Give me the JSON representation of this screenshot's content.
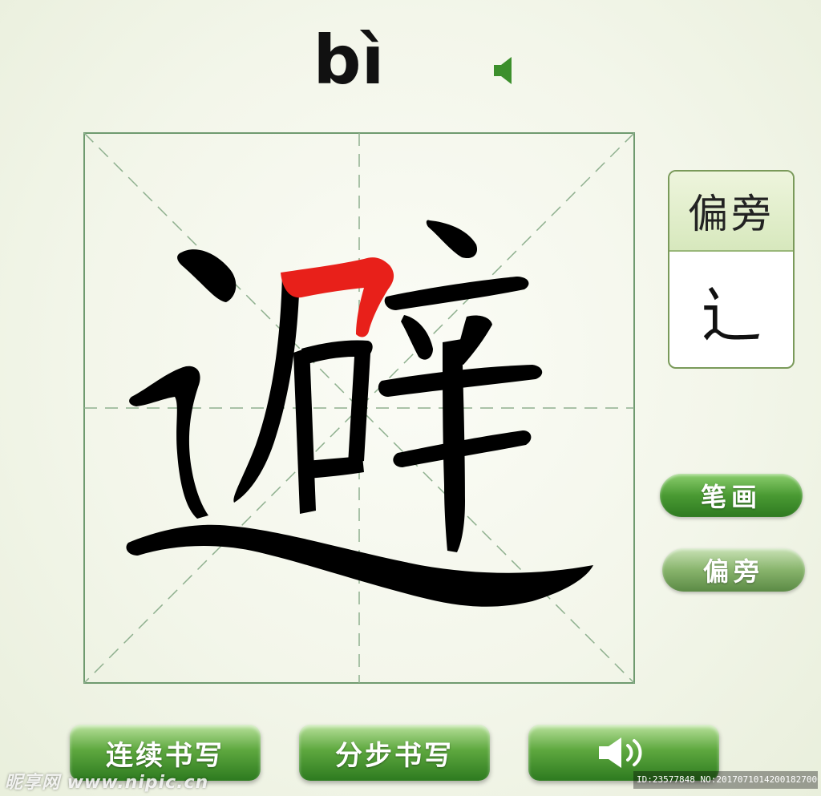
{
  "pinyin": "bì",
  "radical_panel": {
    "title": "偏旁",
    "radical": "辶"
  },
  "side_buttons": {
    "strokes": "笔画",
    "radical": "偏旁"
  },
  "bottom_buttons": {
    "continuous": "连续书写",
    "step": "分步书写"
  },
  "watermark": {
    "site": "昵享网 www.nipic.cn",
    "id": "ID:23577848 NO:20170710142001827000"
  },
  "colors": {
    "stroke": "#000000",
    "highlight_stroke": "#e8201a",
    "grid_line": "#6f9a6f",
    "button_green": "#4a9a33"
  },
  "icons": {
    "pronounce": "speaker-icon",
    "play_audio": "speaker-sound-icon"
  }
}
